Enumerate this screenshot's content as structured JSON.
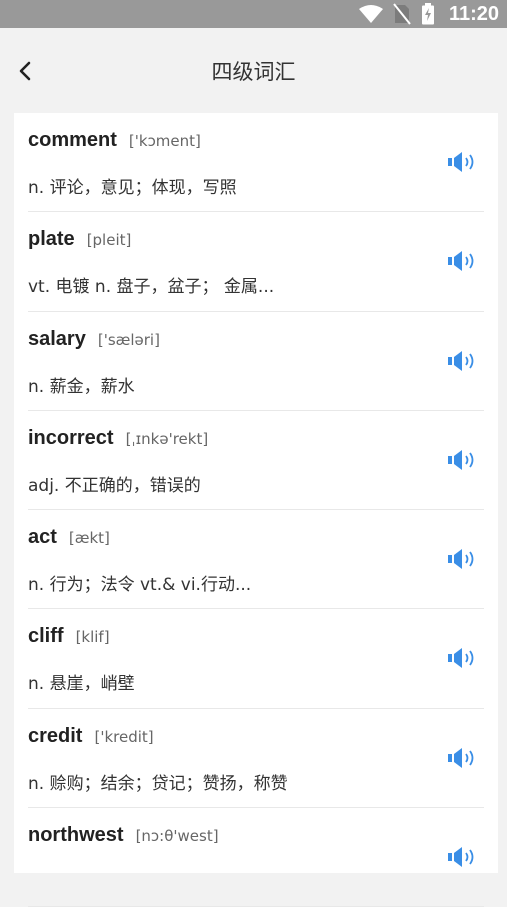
{
  "status_bar": {
    "time": "11:20",
    "icons": [
      "wifi-icon",
      "no-sim-icon",
      "battery-icon"
    ]
  },
  "header": {
    "title": "四级词汇",
    "back_icon": "chevron-left-icon"
  },
  "colors": {
    "status_bar_bg": "#999999",
    "page_bg": "#f2f2f2",
    "card_bg": "#ffffff",
    "speaker_blue": "#3a8ee6"
  },
  "words": [
    {
      "word": "comment",
      "phonetic": "['kɔment]",
      "definition": "n. 评论，意见；体现，写照",
      "icon": "speaker-icon"
    },
    {
      "word": "plate",
      "phonetic": "[pleit]",
      "definition": "vt. 电镀  n. 盘子，盆子；  金属...",
      "icon": "speaker-icon"
    },
    {
      "word": "salary",
      "phonetic": "['sæləri]",
      "definition": "n. 薪金，薪水",
      "icon": "speaker-icon"
    },
    {
      "word": "incorrect",
      "phonetic": "[ˌɪnkə'rekt]",
      "definition": "adj. 不正确的，错误的",
      "icon": "speaker-icon"
    },
    {
      "word": "act",
      "phonetic": "[ækt]",
      "definition": "n. 行为；法令  vt.& vi.行动...",
      "icon": "speaker-icon"
    },
    {
      "word": "cliff",
      "phonetic": "[klif]",
      "definition": "n. 悬崖，峭壁",
      "icon": "speaker-icon"
    },
    {
      "word": "credit",
      "phonetic": "['kredit]",
      "definition": "n. 赊购；结余；贷记；赞扬，称赞",
      "icon": "speaker-icon"
    },
    {
      "word": "northwest",
      "phonetic": "[nɔ:θ'west]",
      "definition": "",
      "icon": "speaker-icon"
    }
  ]
}
